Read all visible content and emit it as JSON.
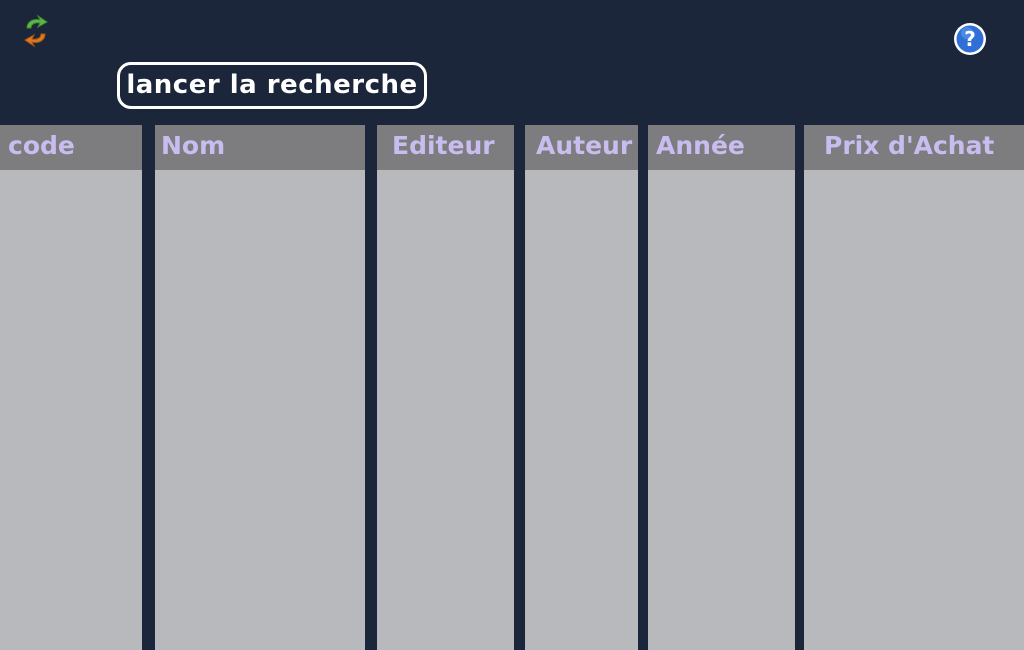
{
  "toolbar": {
    "refresh_icon": "refresh-arrows-icon",
    "help_icon": "question-mark-icon",
    "search_label": "lancer la recherche"
  },
  "table": {
    "columns": [
      {
        "label": "code"
      },
      {
        "label": "Nom"
      },
      {
        "label": "Editeur"
      },
      {
        "label": "Auteur"
      },
      {
        "label": "Année"
      },
      {
        "label": "Prix d'Achat"
      }
    ]
  },
  "colors": {
    "background": "#1c263a",
    "header_bg": "#7d7d7f",
    "header_text": "#c9bdf0",
    "column_bg": "#b8b9bc",
    "help_blue": "#2f6fd6",
    "refresh_green": "#5fb84a",
    "refresh_orange": "#e07a1f"
  }
}
